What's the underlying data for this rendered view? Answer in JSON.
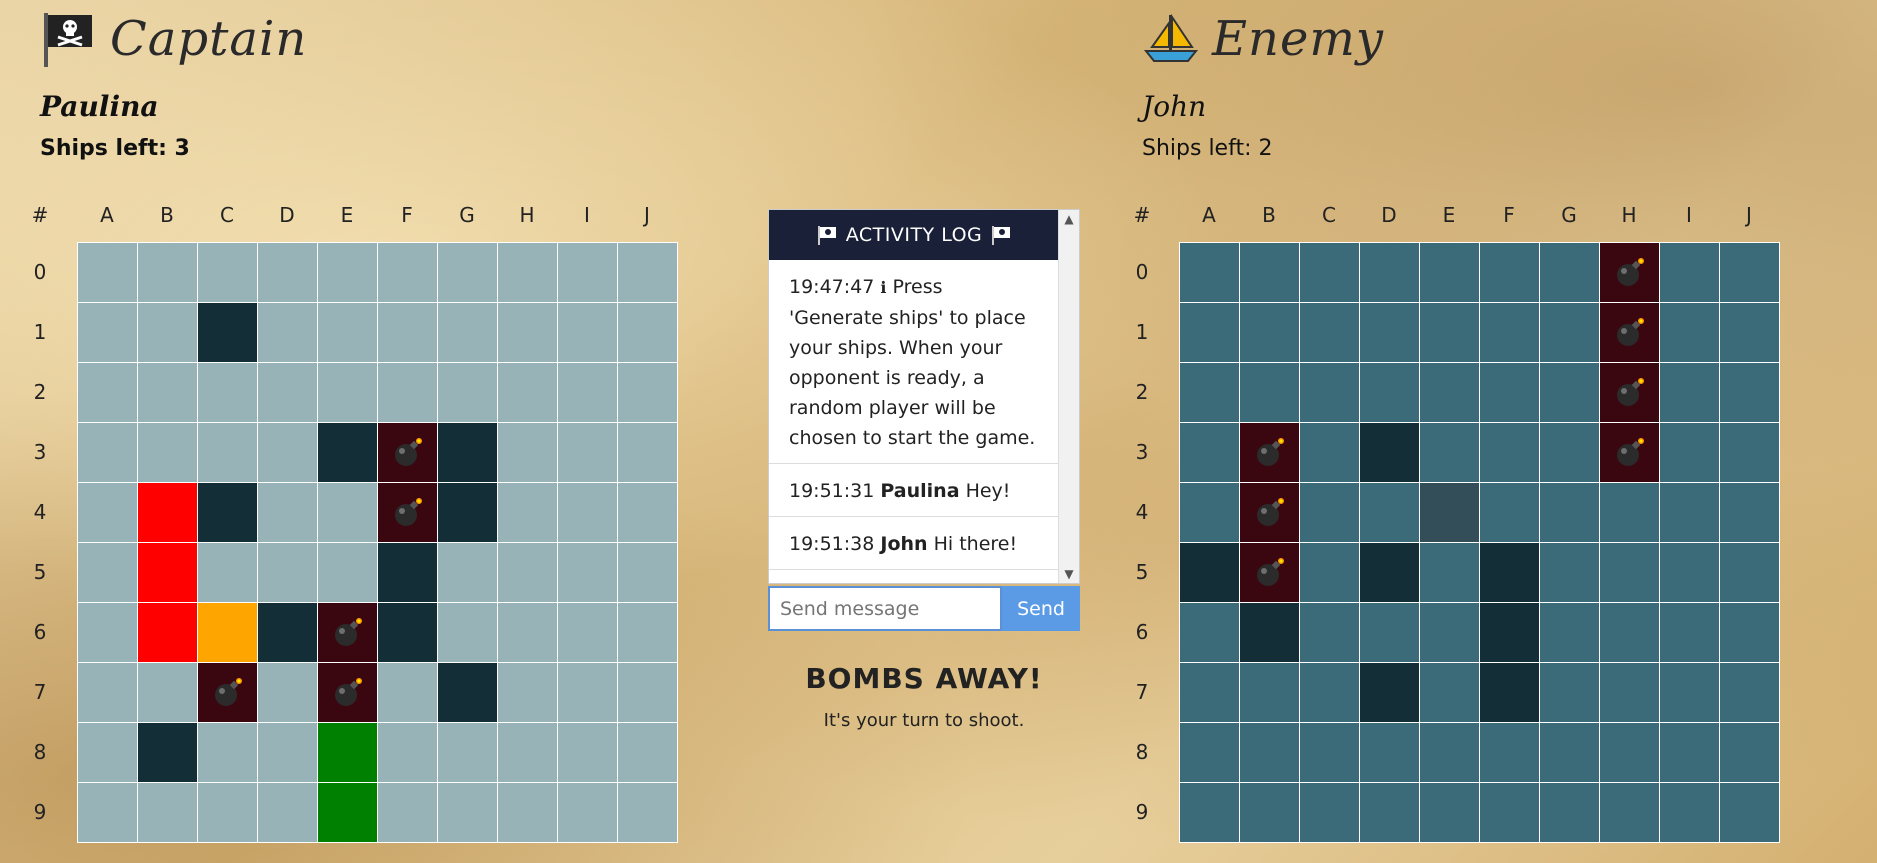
{
  "colors": {
    "water_own": "#97b3b8",
    "water_enemy": "#3b6b79",
    "ship": "#132e36",
    "hit": "#3a0710",
    "sunk_own_red": "#ff0000",
    "sunk_own_orange": "#ffa500",
    "sunk_own_green": "#008000",
    "enemy_highlight": "#344e59"
  },
  "columns": [
    "#",
    "A",
    "B",
    "C",
    "D",
    "E",
    "F",
    "G",
    "H",
    "I",
    "J"
  ],
  "rows": [
    "0",
    "1",
    "2",
    "3",
    "4",
    "5",
    "6",
    "7",
    "8",
    "9"
  ],
  "captain": {
    "title": "Captain",
    "icon": "pirate-flag-icon",
    "name": "Paulina",
    "ships_left": "Ships left: 3",
    "board": [
      "..........",
      "..S.......",
      "..........",
      "....SHS...",
      ".RS..HS...",
      ".R...S....",
      ".ROSHS....",
      "..H.H.S...",
      ".S..G.....",
      "....G....."
    ]
  },
  "enemy": {
    "title": "Enemy",
    "icon": "sailboat-icon",
    "name": "John",
    "ships_left": "Ships left: 2",
    "board": [
      ".......H..",
      ".......H..",
      ".......H..",
      ".H.S...H..",
      ".H..M.....",
      "SH.S.S....",
      ".S...S....",
      "...S.S....",
      "..........",
      ".........."
    ]
  },
  "activity_log": {
    "title": "ACTIVITY LOG",
    "entries": [
      {
        "time": "19:47:47",
        "icon": "ℹ",
        "who": "",
        "text": "Press 'Generate ships' to place your ships. When your opponent is ready, a random player will be chosen to start the game."
      },
      {
        "time": "19:51:31",
        "icon": "",
        "who": "Paulina",
        "text": "Hey!"
      },
      {
        "time": "19:51:38",
        "icon": "",
        "who": "John",
        "text": "Hi there!"
      }
    ]
  },
  "chat": {
    "placeholder": "Send message",
    "send_label": "Send"
  },
  "turn": {
    "title": "BOMBS AWAY!",
    "subtitle": "It's your turn to shoot."
  }
}
